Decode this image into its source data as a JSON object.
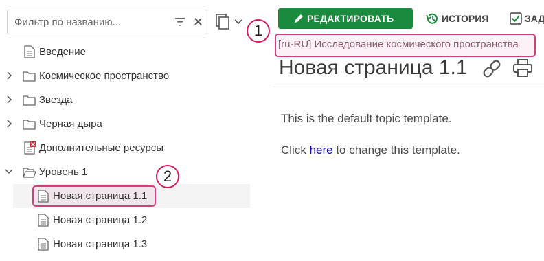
{
  "filter": {
    "placeholder": "Фильтр по названию..."
  },
  "tree": {
    "items": [
      {
        "label": "Введение",
        "icon": "document-icon"
      },
      {
        "label": "Космическое пространство",
        "icon": "folder-icon"
      },
      {
        "label": "Звезда",
        "icon": "folder-icon"
      },
      {
        "label": "Черная дыра",
        "icon": "folder-icon"
      },
      {
        "label": "Дополнительные ресурсы",
        "icon": "document-error-icon"
      },
      {
        "label": "Уровень 1",
        "icon": "folder-open-icon"
      },
      {
        "label": "Новая страница 1.1",
        "icon": "document-icon"
      },
      {
        "label": "Новая страница 1.2",
        "icon": "document-icon"
      },
      {
        "label": "Новая страница 1.3",
        "icon": "document-icon"
      }
    ]
  },
  "toolbar": {
    "edit_label": "РЕДАКТИРОВАТЬ",
    "history_label": "ИСТОРИЯ",
    "tasks_label": "ЗАД"
  },
  "breadcrumb": "[ru-RU] Исследование космического пространства",
  "page_title": "Новая страница 1.1",
  "content": {
    "line1": "This is the default topic template.",
    "line2_prefix": "Click ",
    "line2_link": "here",
    "line2_suffix": " to change this template."
  },
  "annotations": {
    "badge1": "1",
    "badge2": "2"
  },
  "colors": {
    "accent_green": "#1a8a3e",
    "highlight_pink": "#d63d7f",
    "badge_red": "#d11c5e"
  }
}
